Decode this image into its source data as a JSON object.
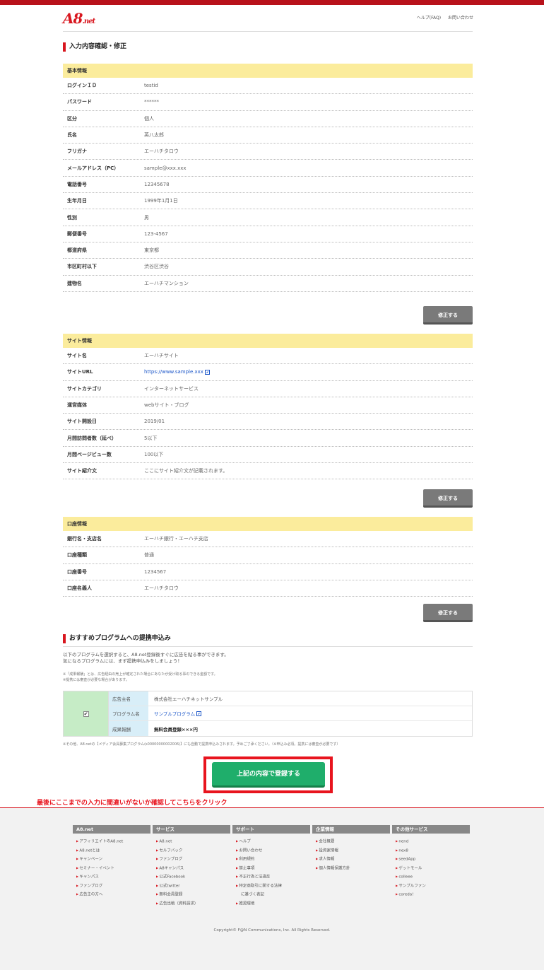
{
  "header": {
    "logo": "A8.net",
    "links": [
      "ヘルプ(FAQ)",
      "お問い合わせ"
    ]
  },
  "page_title": "入力内容確認・修正",
  "sections": [
    {
      "title": "基本情報",
      "rows": [
        {
          "label": "ログインＩＤ",
          "value": "testid"
        },
        {
          "label": "パスワード",
          "value": "******"
        },
        {
          "label": "区分",
          "value": "個人"
        },
        {
          "label": "氏名",
          "value": "英八太郎"
        },
        {
          "label": "フリガナ",
          "value": "エーハチタロウ"
        },
        {
          "label": "メールアドレス（PC）",
          "value": "sample@xxx.xxx"
        },
        {
          "label": "電話番号",
          "value": "12345678"
        },
        {
          "label": "生年月日",
          "value": "1999年1月1日"
        },
        {
          "label": "性別",
          "value": "男"
        },
        {
          "label": "郵便番号",
          "value": "123-4567"
        },
        {
          "label": "都道府県",
          "value": "東京都"
        },
        {
          "label": "市区町村以下",
          "value": "渋谷区渋谷"
        },
        {
          "label": "建物名",
          "value": "エーハチマンション"
        }
      ],
      "edit_label": "修正する"
    },
    {
      "title": "サイト情報",
      "rows": [
        {
          "label": "サイト名",
          "value": "エーハチサイト"
        },
        {
          "label": "サイトURL",
          "value": "https://www.sample.xxx"
        },
        {
          "label": "サイトカテゴリ",
          "value": "インターネットサービス"
        },
        {
          "label": "運営媒体",
          "value": "webサイト・ブログ"
        },
        {
          "label": "サイト開設日",
          "value": "2019/01"
        },
        {
          "label": "月間訪問者数（延べ）",
          "value": "5以下"
        },
        {
          "label": "月間ページビュー数",
          "value": "100以下"
        },
        {
          "label": "サイト紹介文",
          "value": "ここにサイト紹介文が記載されます。"
        }
      ],
      "edit_label": "修正する"
    },
    {
      "title": "口座情報",
      "rows": [
        {
          "label": "銀行名・支店名",
          "value": "エーハチ銀行・エーハチ支店"
        },
        {
          "label": "口座種類",
          "value": "普通"
        },
        {
          "label": "口座番号",
          "value": "1234567"
        },
        {
          "label": "口座名義人",
          "value": "エーハチタロウ"
        }
      ],
      "edit_label": "修正する"
    }
  ],
  "recommend": {
    "title": "おすすめプログラムへの提携申込み",
    "text1": "以下のプログラムを選択すると、A8.net登録後すぐに広告を貼る事ができます。",
    "text2": "気になるプログラムには、まず提携申込みをしましょう！",
    "note1": "※「成果報酬」とは、広告経由の売上が確定された場合にあなたが受け取る事のできる金額です。",
    "note2": "※提携には審査が必要な場合があります。",
    "checked": true,
    "rows": [
      {
        "label": "広告主名",
        "value": "株式会社エーハチネットサンプル"
      },
      {
        "label": "プログラム名",
        "value": "サンプルプログラム"
      },
      {
        "label": "成果報酬",
        "value": "無料会員登録×××円"
      }
    ],
    "other_note": "※その他、A8.netの【メディア会員募集プログラム(s00000000002006)】にも自動で提携申込みされます。予めご了承ください。（※申込み必須。提携には審査が必要です）"
  },
  "submit_label": "上記の内容で登録する",
  "callout": "最後にここまでの入力に間違いがないか確認してこちらをクリック",
  "footer": {
    "columns": [
      {
        "title": "A8.net",
        "items": [
          "アフィリエイトのA8.net",
          "A8.netとは",
          "キャンペーン",
          "セミナー・イベント",
          "キャンパス",
          "ファンブログ",
          "広告主の方へ"
        ]
      },
      {
        "title": "サービス",
        "items": [
          "A8.net",
          "セルフバック",
          "ファンブログ",
          "A8キャンパス",
          "公式Facebook",
          "公式twitter",
          "無料会員登録",
          "広告出稿（資料請求）"
        ]
      },
      {
        "title": "サポート",
        "items": [
          "ヘルプ",
          "お問い合わせ",
          "利用規約",
          "禁止事項",
          "不正行為と法違反",
          "特定商取引に関する法律",
          "に基づく表記",
          "推奨環境"
        ]
      },
      {
        "title": "企業情報",
        "items": [
          "会社概要",
          "投資家情報",
          "求人情報",
          "個人情報保護方針"
        ]
      },
      {
        "title": "その他サービス",
        "items": [
          "nend",
          "nex8",
          "seedApp",
          "ゲットモール",
          "colleee",
          "サンプルファン",
          "coreda!"
        ]
      }
    ],
    "copyright": "Copyright© F@N Communications, Inc. All Rights Reserved."
  }
}
